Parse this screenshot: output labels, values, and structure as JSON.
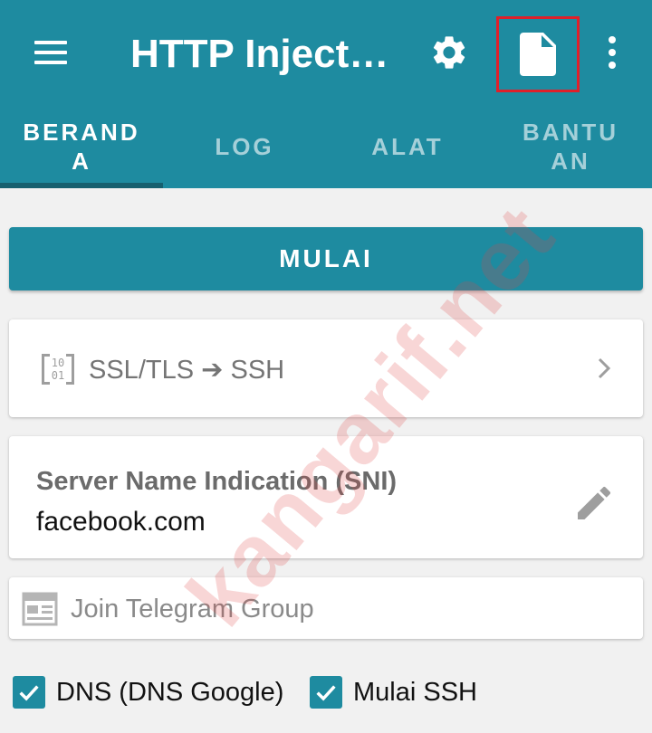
{
  "app": {
    "title": "HTTP Inject…"
  },
  "tabs": [
    {
      "label": "BERANDA",
      "active": true
    },
    {
      "label": "LOG",
      "active": false
    },
    {
      "label": "ALAT",
      "active": false
    },
    {
      "label": "BANTUAN",
      "active": false
    }
  ],
  "main": {
    "start_label": "MULAI",
    "mode": {
      "icon_text": "10\n01",
      "label": "SSL/TLS ➔ SSH"
    },
    "sni": {
      "title": "Server Name Indication (SNI)",
      "value": "facebook.com"
    },
    "telegram_label": "Join Telegram Group",
    "options": [
      {
        "label": "DNS (DNS Google)",
        "checked": true
      },
      {
        "label": "Mulai SSH",
        "checked": true
      }
    ]
  },
  "watermark": "kangarif.net",
  "colors": {
    "primary": "#1e8ba0",
    "primary_dark": "#17606f",
    "highlight_box": "#e0202a",
    "background": "#f1f1f1"
  },
  "icons": [
    "menu-icon",
    "gear-icon",
    "file-icon",
    "more-vert-icon",
    "binary-icon",
    "chevron-right-icon",
    "pencil-icon",
    "newspaper-icon",
    "check-icon"
  ]
}
